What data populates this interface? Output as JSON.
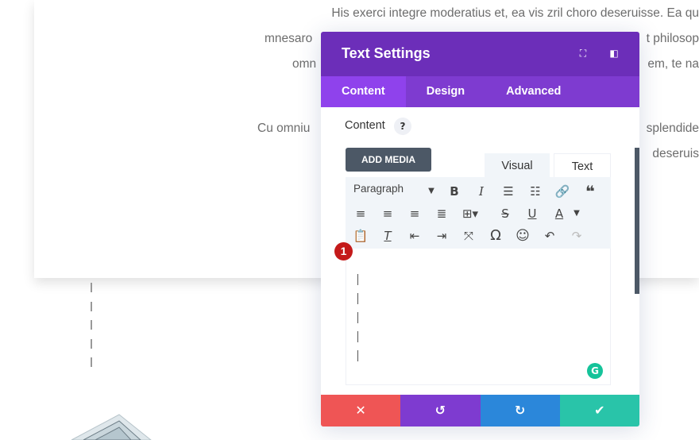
{
  "background_text": {
    "line1": "His exerci integre moderatius et, ea vis zril choro deseruisse. Ea qu",
    "line2_left": "mnesaro",
    "line2_right": "t philosop",
    "line3_left": "omn",
    "line3_right": "em, te na",
    "line4_left": "Cu omniu",
    "line4_right": "splendide",
    "line5_right": "deseruis"
  },
  "modal": {
    "title": "Text Settings",
    "header_icons": [
      "fullscreen-icon",
      "split-view-icon"
    ],
    "tabs": [
      {
        "label": "Content",
        "active": true
      },
      {
        "label": "Design"
      },
      {
        "label": "Advanced"
      }
    ],
    "section_label": "Content",
    "help": "?",
    "add_media": "ADD MEDIA",
    "editor_tabs": [
      {
        "label": "Visual",
        "active": true
      },
      {
        "label": "Text"
      }
    ],
    "format_select": "Paragraph",
    "badge": "1",
    "footer_colors": {
      "cancel": "#ef5555",
      "undo": "#7e3bd0",
      "redo": "#2b87da",
      "save": "#29c4a9"
    }
  },
  "colors": {
    "header": "#6c2eb9",
    "tabs": "#7e3bd0",
    "active_tab": "#8f42ec"
  }
}
